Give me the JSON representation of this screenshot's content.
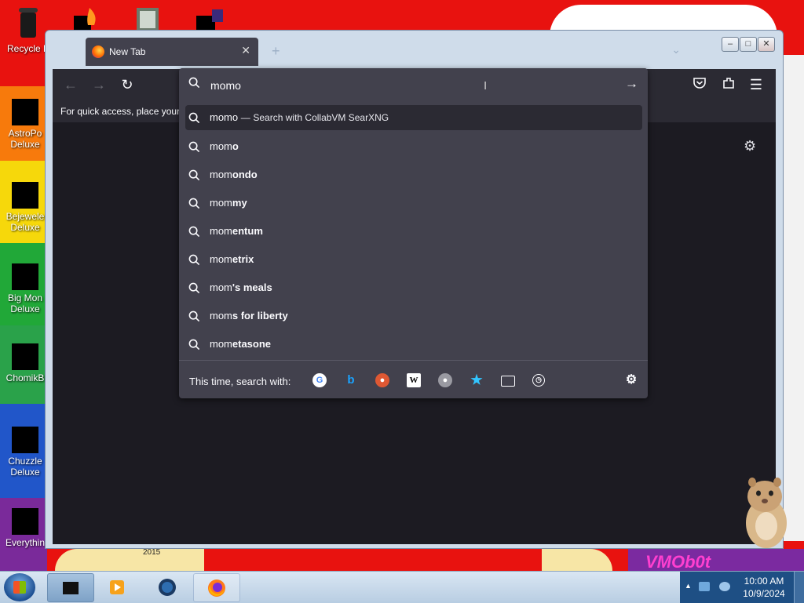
{
  "desktop": {
    "icons": [
      {
        "label_line1": "Recycle B",
        "label_line2": ""
      },
      {
        "label_line1": "AstroPo",
        "label_line2": "Deluxe"
      },
      {
        "label_line1": "Bejewele",
        "label_line2": "Deluxe"
      },
      {
        "label_line1": "Big Mon",
        "label_line2": "Deluxe"
      },
      {
        "label_line1": "ChomikB",
        "label_line2": ""
      },
      {
        "label_line1": "Chuzzle",
        "label_line2": "Deluxe"
      },
      {
        "label_line1": "Everythin",
        "label_line2": ""
      }
    ],
    "wallpaper_year": "2015",
    "wallpaper_brand": "VMOb0t"
  },
  "browser": {
    "tab_title": "New Tab",
    "bookmarks_hint": "For quick access, place your b",
    "urlbar": {
      "value": "momo"
    },
    "first_suggestion": {
      "query": "momo",
      "separator": "—",
      "engine_text": "Search with CollabVM SearXNG"
    },
    "suggestions": [
      {
        "typed": "mom",
        "rest": "o"
      },
      {
        "typed": "mom",
        "rest": "ondo"
      },
      {
        "typed": "mom",
        "rest": "my"
      },
      {
        "typed": "mom",
        "rest": "entum"
      },
      {
        "typed": "mom",
        "rest": "etrix"
      },
      {
        "typed": "mom",
        "rest": "'s meals"
      },
      {
        "typed": "mom",
        "rest": "s for liberty"
      },
      {
        "typed": "mom",
        "rest": "etasone"
      }
    ],
    "search_with_label": "This time, search with:",
    "engines": [
      "google-icon",
      "bing-icon",
      "duckduckgo-icon",
      "wikipedia-icon",
      "searxng-icon",
      "bookmarks-icon",
      "tabs-icon",
      "history-icon"
    ]
  },
  "taskbar": {
    "time": "10:00 AM",
    "date": "10/9/2024"
  },
  "colors": {
    "toolbar": "#2b2a33",
    "panel": "#42414d",
    "content": "#1c1b22"
  }
}
